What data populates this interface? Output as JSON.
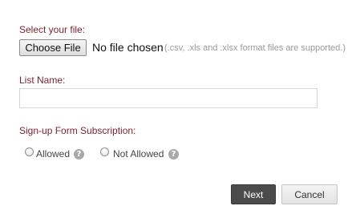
{
  "file_section": {
    "label": "Select your file:",
    "choose_button": "Choose File",
    "status": "No file chosen",
    "hint": "(.csv, .xls and .xlsx format files are supported.)"
  },
  "list_name": {
    "label": "List Name:",
    "value": ""
  },
  "subscription": {
    "label": "Sign-up Form Subscription:",
    "options": [
      {
        "label": "Allowed",
        "help_glyph": "?"
      },
      {
        "label": "Not Allowed",
        "help_glyph": "?"
      }
    ]
  },
  "actions": {
    "next": "Next",
    "cancel": "Cancel"
  },
  "colors": {
    "label_color": "#7b1f2a",
    "primary_button": "#4b4b4b"
  }
}
